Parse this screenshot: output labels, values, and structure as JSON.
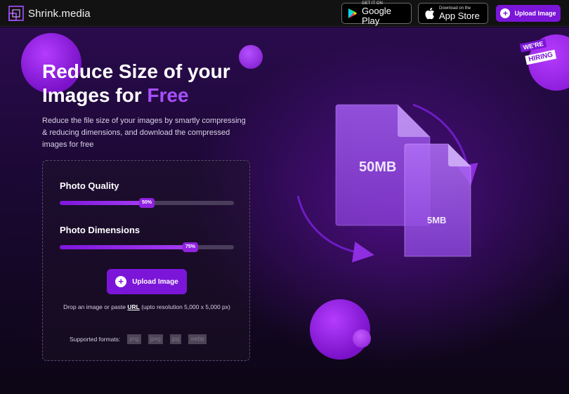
{
  "header": {
    "brand": "Shrink.media",
    "google_play": {
      "small": "GET IT ON",
      "big": "Google Play"
    },
    "app_store": {
      "small": "Download on the",
      "big": "App Store"
    },
    "upload_label": "Upload Image"
  },
  "hero": {
    "headline_line1": "Reduce Size of your",
    "headline_line2_prefix": "Images for ",
    "headline_accent": "Free",
    "subtext": "Reduce the file size of your images by smartly compressing & reducing dimensions, and download the compressed images for free"
  },
  "card": {
    "quality_label": "Photo Quality",
    "quality_value": 50,
    "quality_text": "50%",
    "dimensions_label": "Photo Dimensions",
    "dimensions_value": 75,
    "dimensions_text": "75%",
    "upload_label": "Upload Image",
    "drop_prefix": "Drop an image or paste ",
    "drop_link": "URL",
    "drop_suffix": " (upto resolution 5,000 x 5,000 px)",
    "formats_label": "Supported formats:",
    "formats": [
      "png",
      "jpeg",
      "jpg",
      "webp"
    ]
  },
  "illustration": {
    "big_file": "50MB",
    "small_file": "5MB",
    "hiring_line1": "WE'RE",
    "hiring_line2": "HIRING"
  },
  "colors": {
    "accent": "#7b16d9",
    "accent_light": "#a84fff",
    "header_bg": "#121212"
  }
}
